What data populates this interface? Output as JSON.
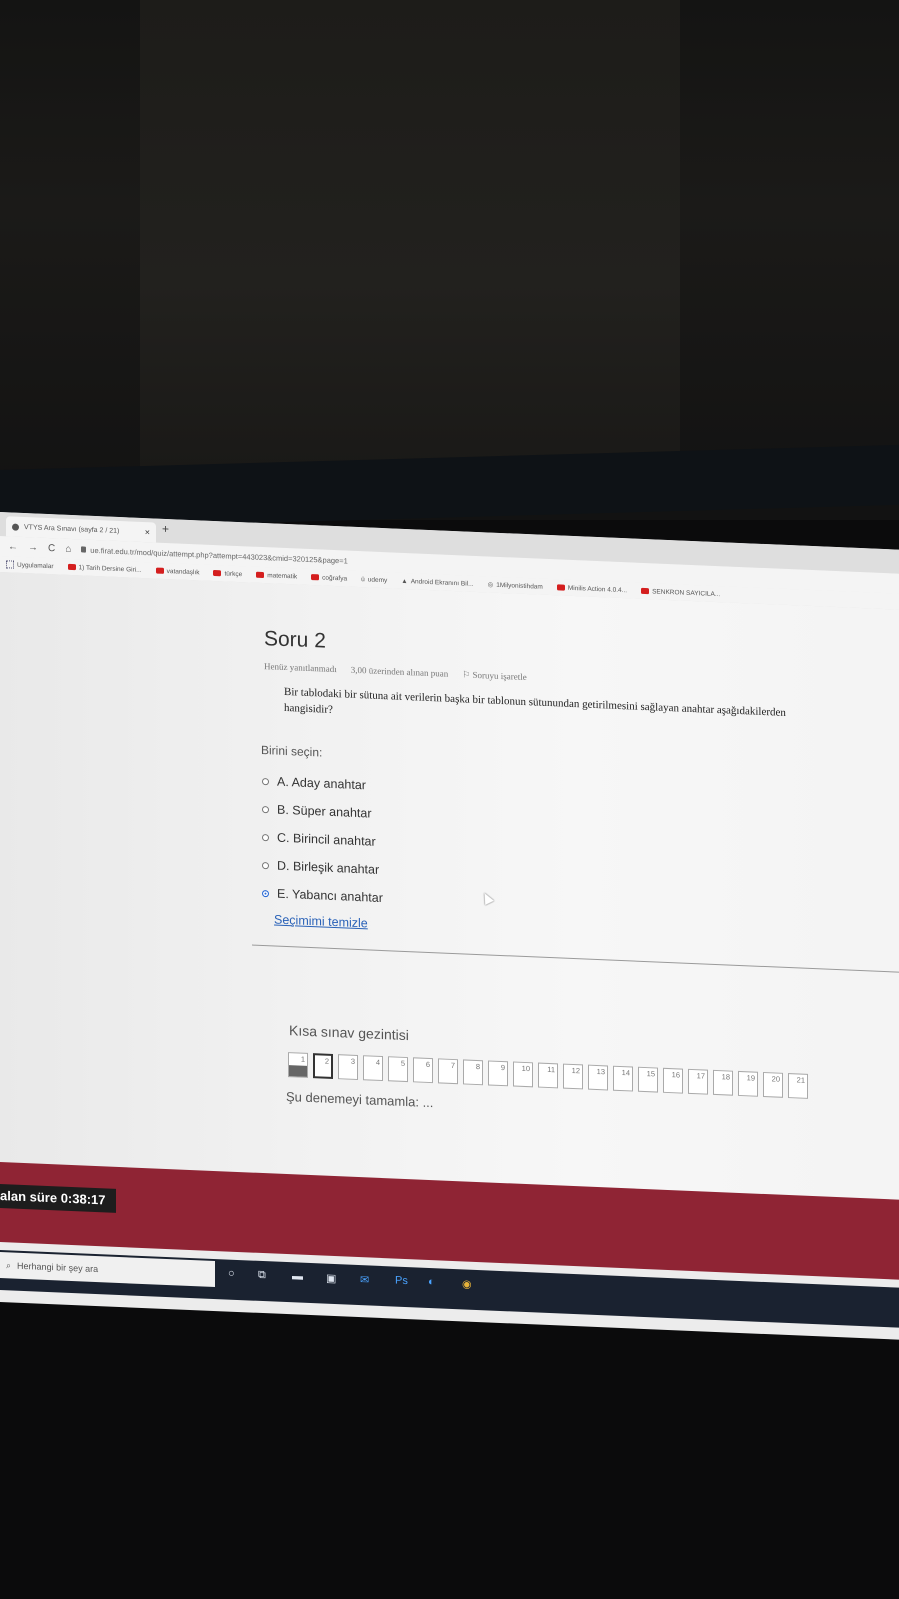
{
  "browser": {
    "tab_title": "VTYS Ara Sınavı (sayfa 2 / 21)",
    "tab_close": "×",
    "new_tab": "+",
    "nav_back": "←",
    "nav_forward": "→",
    "nav_reload": "C",
    "nav_home": "⌂",
    "url": "ue.firat.edu.tr/mod/quiz/attempt.php?attempt=443023&cmid=320125&page=1",
    "bookmarks": [
      "Uygulamalar",
      "1) Tarih Dersine Giri...",
      "vatandaşlık",
      "türkçe",
      "matematik",
      "coğrafya",
      "udemy",
      "Android Ekranını Bil...",
      "1Milyonistihdam",
      "Minilis Action 4.0.4...",
      "SENKRON SAYICILA..."
    ]
  },
  "question": {
    "title": "Soru 2",
    "status": "Henüz yanıtlanmadı",
    "points": "3,00 üzerinden alınan puan",
    "flag": "Soruyu işaretle",
    "text": "Bir tablodaki bir sütuna ait verilerin başka bir tablonun sütunundan getirilmesini sağlayan anahtar aşağıdakilerden hangisidir?",
    "prompt": "Birini seçin:",
    "options": [
      {
        "label": "A. Aday anahtar",
        "selected": false
      },
      {
        "label": "B. Süper anahtar",
        "selected": false
      },
      {
        "label": "C. Birincil anahtar",
        "selected": false
      },
      {
        "label": "D. Birleşik anahtar",
        "selected": false
      },
      {
        "label": "E. Yabancı anahtar",
        "selected": true
      }
    ],
    "clear_label": "Seçimimi temizle"
  },
  "quiz_nav": {
    "title": "Kısa sınav gezintisi",
    "questions": [
      "1",
      "2",
      "3",
      "4",
      "5",
      "6",
      "7",
      "8",
      "9",
      "10",
      "11",
      "12",
      "13",
      "14",
      "15",
      "16",
      "17",
      "18",
      "19",
      "20",
      "21"
    ],
    "answered": [
      "1"
    ],
    "current": "2",
    "finish_label": "Şu denemeyi tamamla: ..."
  },
  "timer": {
    "label": "alan süre 0:38:17"
  },
  "taskbar": {
    "search_placeholder": "Herhangi bir şey ara"
  },
  "colors": {
    "accent_red": "#8f2434",
    "link_blue": "#2a62b8",
    "radio_selected": "#2a6ad6"
  }
}
